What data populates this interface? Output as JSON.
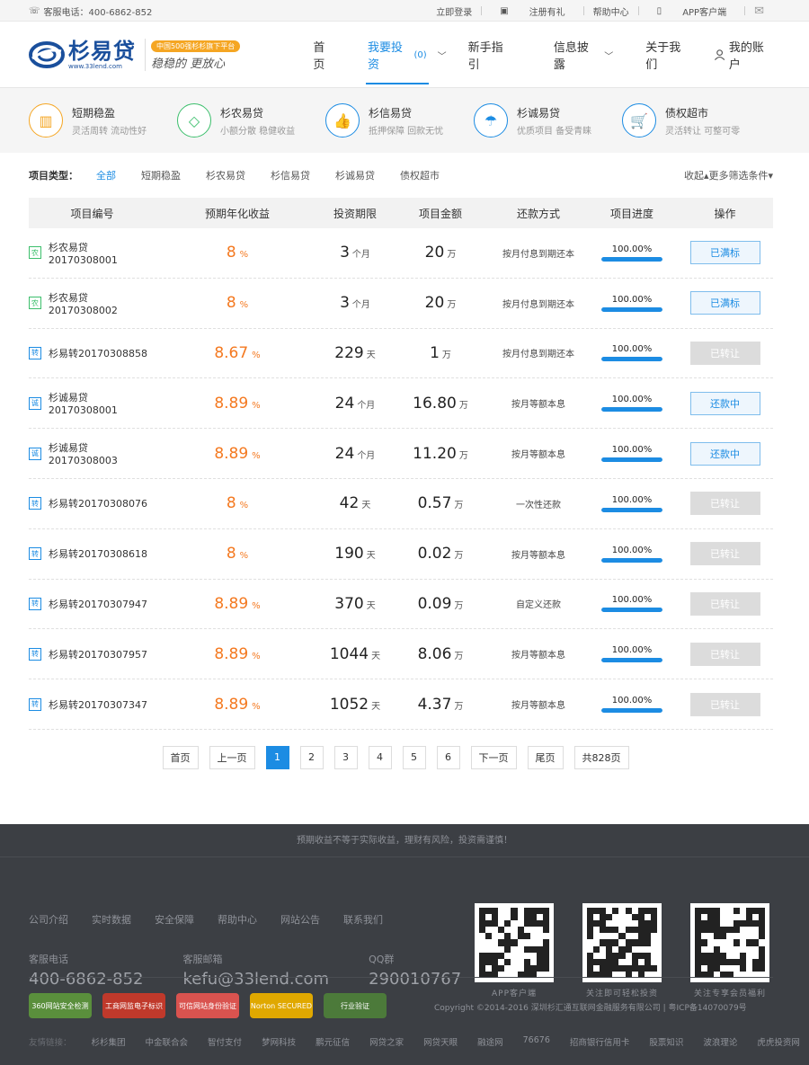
{
  "topbar": {
    "phone": "客服电话：400-6862-852",
    "login": "立即登录",
    "register": "注册有礼",
    "help": "帮助中心",
    "app": "APP客户端"
  },
  "header": {
    "logo_name": "杉易贷",
    "logo_url": "www.33lend.com",
    "slogan_badge": "中国500强杉杉旗下平台",
    "slogan_text": "稳稳的  更放心",
    "nav": [
      {
        "label": "首页"
      },
      {
        "label": "我要投资",
        "badge": "(0)"
      },
      {
        "label": "新手指引"
      },
      {
        "label": "信息披露"
      },
      {
        "label": "关于我们"
      }
    ],
    "account": "我的账户"
  },
  "categories": [
    {
      "title": "短期稳盈",
      "sub": "灵活周转 流动性好",
      "color": "#f5a623",
      "icon": "chart-bars-icon"
    },
    {
      "title": "杉农易贷",
      "sub": "小额分散 稳健收益",
      "color": "#3cbf6c",
      "icon": "gem-icon"
    },
    {
      "title": "杉信易贷",
      "sub": "抵押保障 回款无忧",
      "color": "#1c8ce3",
      "icon": "thumbs-up-icon"
    },
    {
      "title": "杉诚易贷",
      "sub": "优质项目 备受青睐",
      "color": "#1c8ce3",
      "icon": "umbrella-icon"
    },
    {
      "title": "债权超市",
      "sub": "灵活转让 可整可零",
      "color": "#1c8ce3",
      "icon": "cart-icon"
    }
  ],
  "filter": {
    "label": "项目类型：",
    "options": [
      "全部",
      "短期稳盈",
      "杉农易贷",
      "杉信易贷",
      "杉诚易贷",
      "债权超市"
    ],
    "more": "收起▴更多筛选条件▾"
  },
  "table": {
    "headers": [
      "项目编号",
      "预期年化收益",
      "投资期限",
      "项目金额",
      "还款方式",
      "项目进度",
      "操作"
    ],
    "rows": [
      {
        "tag": "农",
        "tag_color": "#3cbf6c",
        "name": "杉农易贷20170308001",
        "rate": "8",
        "rate_unit": "%",
        "term": "3",
        "term_unit": "个月",
        "amount": "20",
        "amount_unit": "万",
        "pay": "按月付息到期还本",
        "progress": "100.00%",
        "progress_value": 1.0,
        "action": "已满标",
        "action_style": "blue"
      },
      {
        "tag": "农",
        "tag_color": "#3cbf6c",
        "name": "杉农易贷20170308002",
        "rate": "8",
        "rate_unit": "%",
        "term": "3",
        "term_unit": "个月",
        "amount": "20",
        "amount_unit": "万",
        "pay": "按月付息到期还本",
        "progress": "100.00%",
        "progress_value": 1.0,
        "action": "已满标",
        "action_style": "blue"
      },
      {
        "tag": "转",
        "tag_color": "#1c8ce3",
        "name": "杉易转20170308858",
        "rate": "8.67",
        "rate_unit": "%",
        "term": "229",
        "term_unit": "天",
        "amount": "1",
        "amount_unit": "万",
        "pay": "按月付息到期还本",
        "progress": "100.00%",
        "progress_value": 1.0,
        "action": "已转让",
        "action_style": "gray"
      },
      {
        "tag": "诚",
        "tag_color": "#1c8ce3",
        "name": "杉诚易贷20170308001",
        "rate": "8.89",
        "rate_unit": "%",
        "term": "24",
        "term_unit": "个月",
        "amount": "16.80",
        "amount_unit": "万",
        "pay": "按月等额本息",
        "progress": "100.00%",
        "progress_value": 1.0,
        "action": "还款中",
        "action_style": "blue"
      },
      {
        "tag": "诚",
        "tag_color": "#1c8ce3",
        "name": "杉诚易贷20170308003",
        "rate": "8.89",
        "rate_unit": "%",
        "term": "24",
        "term_unit": "个月",
        "amount": "11.20",
        "amount_unit": "万",
        "pay": "按月等额本息",
        "progress": "100.00%",
        "progress_value": 1.0,
        "action": "还款中",
        "action_style": "blue"
      },
      {
        "tag": "转",
        "tag_color": "#1c8ce3",
        "name": "杉易转20170308076",
        "rate": "8",
        "rate_unit": "%",
        "term": "42",
        "term_unit": "天",
        "amount": "0.57",
        "amount_unit": "万",
        "pay": "一次性还款",
        "progress": "100.00%",
        "progress_value": 1.0,
        "action": "已转让",
        "action_style": "gray"
      },
      {
        "tag": "转",
        "tag_color": "#1c8ce3",
        "name": "杉易转20170308618",
        "rate": "8",
        "rate_unit": "%",
        "term": "190",
        "term_unit": "天",
        "amount": "0.02",
        "amount_unit": "万",
        "pay": "按月等额本息",
        "progress": "100.00%",
        "progress_value": 1.0,
        "action": "已转让",
        "action_style": "gray"
      },
      {
        "tag": "转",
        "tag_color": "#1c8ce3",
        "name": "杉易转20170307947",
        "rate": "8.89",
        "rate_unit": "%",
        "term": "370",
        "term_unit": "天",
        "amount": "0.09",
        "amount_unit": "万",
        "pay": "自定义还款",
        "progress": "100.00%",
        "progress_value": 1.0,
        "action": "已转让",
        "action_style": "gray"
      },
      {
        "tag": "转",
        "tag_color": "#1c8ce3",
        "name": "杉易转20170307957",
        "rate": "8.89",
        "rate_unit": "%",
        "term": "1044",
        "term_unit": "天",
        "amount": "8.06",
        "amount_unit": "万",
        "pay": "按月等额本息",
        "progress": "100.00%",
        "progress_value": 1.0,
        "action": "已转让",
        "action_style": "gray"
      },
      {
        "tag": "转",
        "tag_color": "#1c8ce3",
        "name": "杉易转20170307347",
        "rate": "8.89",
        "rate_unit": "%",
        "term": "1052",
        "term_unit": "天",
        "amount": "4.37",
        "amount_unit": "万",
        "pay": "按月等额本息",
        "progress": "100.00%",
        "progress_value": 1.0,
        "action": "已转让",
        "action_style": "gray"
      }
    ]
  },
  "pager": {
    "items": [
      "首页",
      "上一页",
      "1",
      "2",
      "3",
      "4",
      "5",
      "6",
      "下一页",
      "尾页",
      "共828页"
    ],
    "current": "1"
  },
  "footer": {
    "risk": "预期收益不等于实际收益，理财有风险，投资需谨慎！",
    "links": [
      "公司介绍",
      "实时数据",
      "安全保障",
      "帮助中心",
      "网站公告",
      "联系我们"
    ],
    "contacts": [
      {
        "label": "客服电话",
        "value": "400-6862-852"
      },
      {
        "label": "客服邮箱",
        "value": "kefu@33lend.com"
      },
      {
        "label": "QQ群",
        "value": "290010767"
      }
    ],
    "qrs": [
      "APP客户端",
      "关注即可轻松投资",
      "关注专享会员福利"
    ],
    "certs": [
      {
        "label": "360网站安全检测",
        "color": "#5a8f3c"
      },
      {
        "label": "工商网监电子标识",
        "color": "#c0392b"
      },
      {
        "label": "可信网站身份验证",
        "color": "#d9534f"
      },
      {
        "label": "Norton SECURED",
        "color": "#e0a800"
      },
      {
        "label": "行业验证",
        "color": "#4c7a3a"
      }
    ],
    "copyright": "Copyright ©2014-2016 深圳杉汇通互联网金融服务有限公司 | 粤ICP备14070079号",
    "friends_label": "友情链接：",
    "friends": [
      "杉杉集团",
      "中金联合会",
      "智付支付",
      "梦网科技",
      "鹏元征信",
      "网贷之家",
      "网贷天眼",
      "融途网",
      "76676",
      "招商银行信用卡",
      "股票知识",
      "波浪理论",
      "虎虎投资网"
    ]
  }
}
